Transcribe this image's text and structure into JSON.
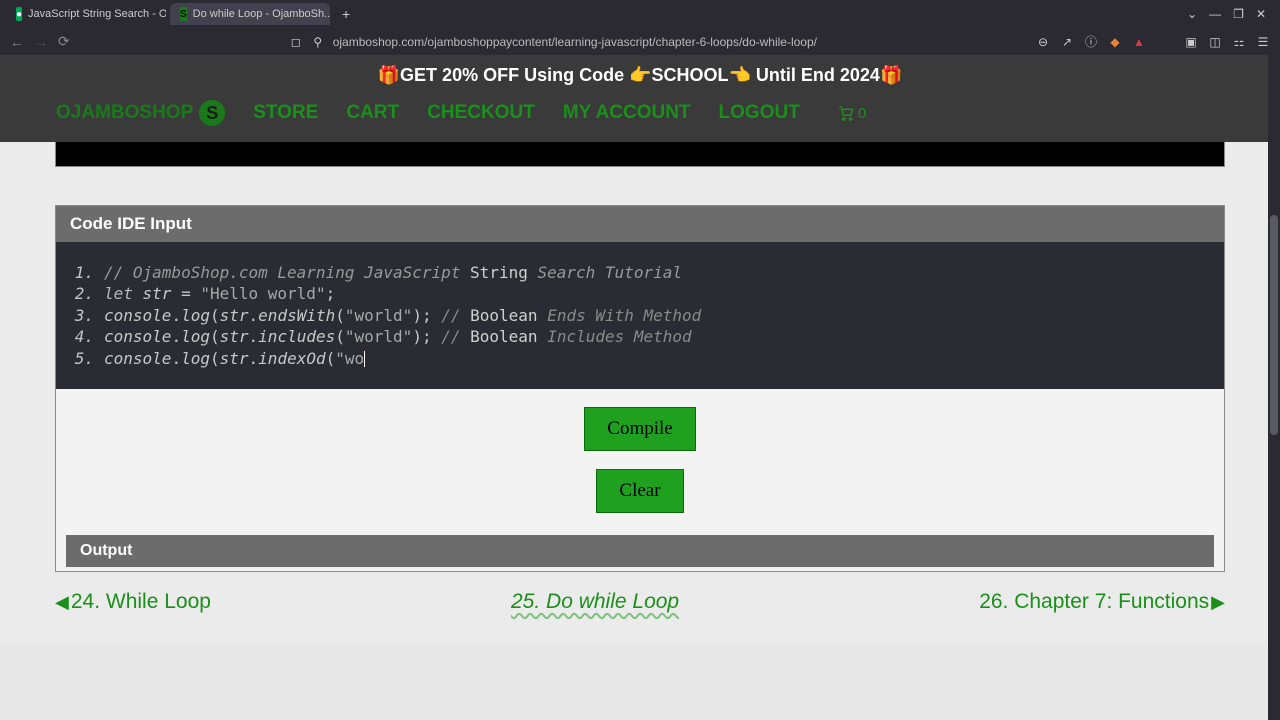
{
  "browser": {
    "tabs": [
      {
        "favicon": "🟢",
        "title": "JavaScript String Search - Ojam..."
      },
      {
        "favicon": "S",
        "title": "Do while Loop - OjamboSh..."
      }
    ],
    "url": "ojamboshop.com/ojamboshoppaycontent/learning-javascript/chapter-6-loops/do-while-loop/"
  },
  "promo": {
    "text_left": "🎁GET 20% OFF Using Code ",
    "code": "👉SCHOOL👈",
    "text_right": " Until End 2024🎁"
  },
  "nav": {
    "brand": "OJAMBOSHOP",
    "items": [
      "STORE",
      "CART",
      "CHECKOUT",
      "MY ACCOUNT",
      "LOGOUT"
    ],
    "cart_count": "0"
  },
  "ide": {
    "input_title": "Code IDE Input",
    "code": [
      {
        "n": "1.",
        "segs": [
          {
            "c": "tok-comment",
            "t": "// OjamboShop.com Learning JavaScript "
          },
          {
            "c": "tok-plain",
            "t": "String "
          },
          {
            "c": "tok-comment",
            "t": "Search Tutorial"
          }
        ]
      },
      {
        "n": "2.",
        "segs": [
          {
            "c": "tok-kw",
            "t": "let "
          },
          {
            "c": "tok-id",
            "t": "str"
          },
          {
            "c": "tok-punc",
            "t": " = "
          },
          {
            "c": "tok-str",
            "t": "\"Hello world\""
          },
          {
            "c": "tok-punc",
            "t": ";"
          }
        ]
      },
      {
        "n": "3.",
        "segs": [
          {
            "c": "tok-id",
            "t": "console"
          },
          {
            "c": "tok-punc",
            "t": "."
          },
          {
            "c": "tok-func",
            "t": "log"
          },
          {
            "c": "tok-punc",
            "t": "("
          },
          {
            "c": "tok-id",
            "t": "str"
          },
          {
            "c": "tok-punc",
            "t": "."
          },
          {
            "c": "tok-func",
            "t": "endsWith"
          },
          {
            "c": "tok-punc",
            "t": "("
          },
          {
            "c": "tok-str",
            "t": "\"world\""
          },
          {
            "c": "tok-punc",
            "t": "); "
          },
          {
            "c": "tok-comment2",
            "t": "// "
          },
          {
            "c": "tok-plain",
            "t": "Boolean "
          },
          {
            "c": "tok-comment2",
            "t": "Ends With Method"
          }
        ]
      },
      {
        "n": "4.",
        "segs": [
          {
            "c": "tok-id",
            "t": "console"
          },
          {
            "c": "tok-punc",
            "t": "."
          },
          {
            "c": "tok-func",
            "t": "log"
          },
          {
            "c": "tok-punc",
            "t": "("
          },
          {
            "c": "tok-id",
            "t": "str"
          },
          {
            "c": "tok-punc",
            "t": "."
          },
          {
            "c": "tok-func",
            "t": "includes"
          },
          {
            "c": "tok-punc",
            "t": "("
          },
          {
            "c": "tok-str",
            "t": "\"world\""
          },
          {
            "c": "tok-punc",
            "t": "); "
          },
          {
            "c": "tok-comment2",
            "t": "// "
          },
          {
            "c": "tok-plain",
            "t": "Boolean "
          },
          {
            "c": "tok-comment2",
            "t": "Includes Method"
          }
        ]
      },
      {
        "n": "5.",
        "segs": [
          {
            "c": "tok-id",
            "t": "console"
          },
          {
            "c": "tok-punc",
            "t": "."
          },
          {
            "c": "tok-func",
            "t": "log"
          },
          {
            "c": "tok-punc",
            "t": "("
          },
          {
            "c": "tok-id",
            "t": "str"
          },
          {
            "c": "tok-punc",
            "t": "."
          },
          {
            "c": "tok-func",
            "t": "indexOd"
          },
          {
            "c": "tok-punc",
            "t": "("
          },
          {
            "c": "tok-str",
            "t": "\"wo"
          }
        ],
        "cursor": true
      }
    ],
    "compile": "Compile",
    "clear": "Clear",
    "output_title": "Output"
  },
  "pager": {
    "prev": "24. While Loop",
    "current": "25. Do while Loop",
    "next": "26. Chapter 7: Functions"
  }
}
